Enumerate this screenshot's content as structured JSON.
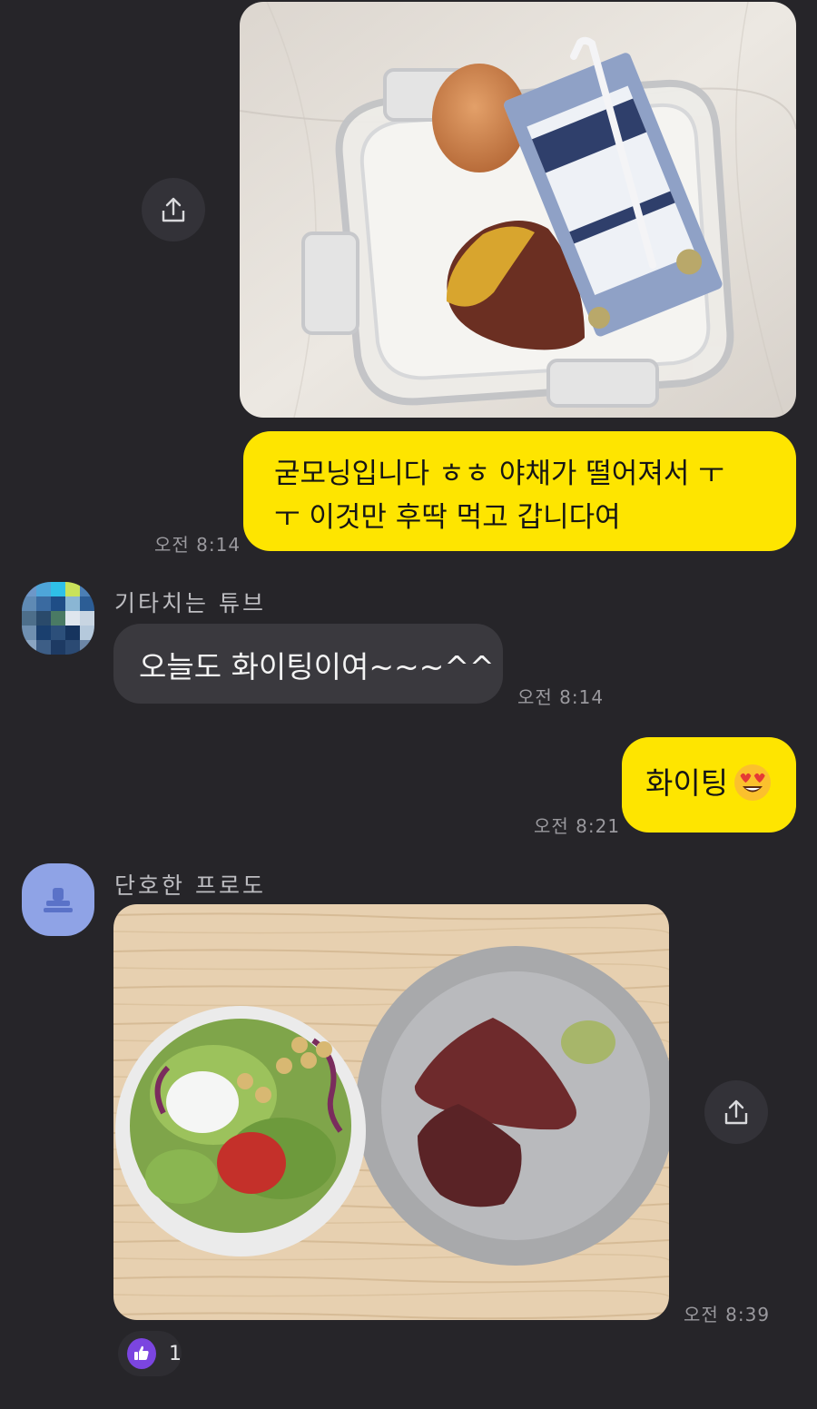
{
  "messages": {
    "m1": {
      "time": "오전 8:14"
    },
    "m2": {
      "line1": "굳모닝입니다 ㅎㅎ 야채가 떨어져서 ㅜ",
      "line2": "ㅜ 이것만 후딱 먹고 갑니다여",
      "time": "오전 8:14"
    },
    "m3": {
      "sender": "기타치는 튜브",
      "text": "오늘도 화이팅이여~~~^^",
      "time": "오전 8:14"
    },
    "m4": {
      "text": "화이팅",
      "time": "오전 8:21"
    },
    "m5": {
      "sender": "단호한 프로도",
      "time": "오전 8:39",
      "reaction_count": "1"
    }
  },
  "icons": {
    "share": "share-icon",
    "reaction": "thumbs-up-icon",
    "emoji": "heart-eyes-emoji"
  },
  "colors": {
    "background": "#262529",
    "my_bubble": "#fee500",
    "other_bubble": "#3a393e",
    "reaction": "#7b45e0",
    "default_avatar": "#8fa3e6"
  }
}
